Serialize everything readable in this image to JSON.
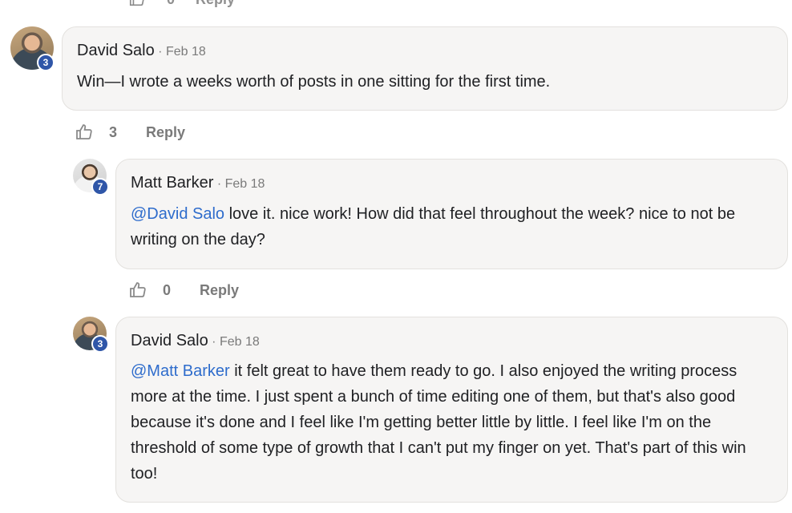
{
  "top_fragment": {
    "count": "0",
    "reply_label": "Reply"
  },
  "comments": [
    {
      "author": "David Salo",
      "date": "· Feb 18",
      "badge": "3",
      "text": "Win—I wrote a weeks worth of posts in one sitting for the first time.",
      "likes": "3",
      "reply_label": "Reply"
    },
    {
      "author": "Matt Barker",
      "date": "· Feb 18",
      "badge": "7",
      "mention": "@David Salo",
      "text": " love it. nice work! How did that feel throughout the week? nice to not be writing on the day?",
      "likes": "0",
      "reply_label": "Reply"
    },
    {
      "author": "David Salo",
      "date": "· Feb 18",
      "badge": "3",
      "mention": "@Matt Barker",
      "text": " it felt great to have them ready to go. I also enjoyed the writing process more at the time. I just spent a bunch of time editing one of them, but that's also good because it's done and I feel like I'm getting better little by little. I feel like I'm on the threshold of some type of growth that I can't put my finger on yet. That's part of this win too!"
    }
  ],
  "icons": {
    "like": "thumbs-up-icon"
  },
  "colors": {
    "mention": "#2e6ccc",
    "badge": "#2f56a8",
    "bubble": "#f6f5f4"
  }
}
